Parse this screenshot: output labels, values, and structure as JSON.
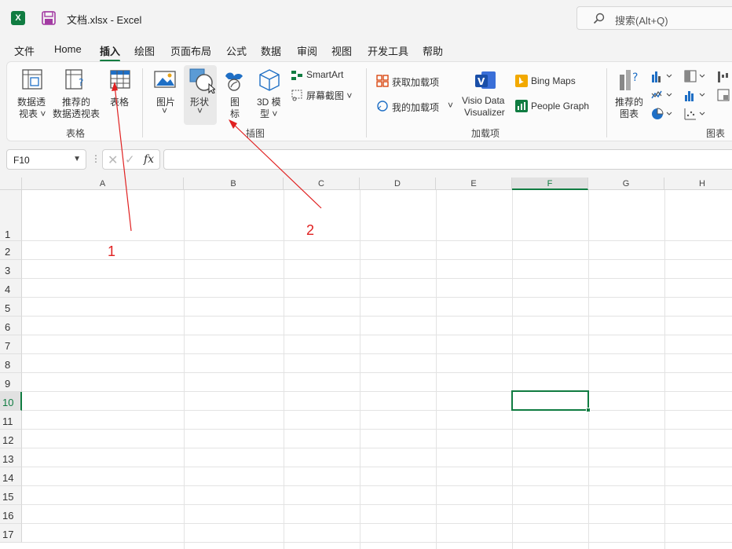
{
  "titlebar": {
    "logo": "X",
    "doc_title": "文档.xlsx  -  Excel",
    "search_placeholder": "搜索(Alt+Q)"
  },
  "tabs": [
    "文件",
    "Home",
    "插入",
    "绘图",
    "页面布局",
    "公式",
    "数据",
    "审阅",
    "视图",
    "开发工具",
    "帮助"
  ],
  "active_tab": "插入",
  "ribbon": {
    "tables_group": {
      "label": "表格",
      "pivot_line1": "数据透",
      "pivot_line2": "视表",
      "rec_pivot_line1": "推荐的",
      "rec_pivot_line2": "数据透视表",
      "table": "表格"
    },
    "illustrations_group": {
      "label": "插图",
      "pictures": "图片",
      "shapes": "形状",
      "icons_line1": "图",
      "icons_line2": "标",
      "model_line1": "3D 模",
      "model_line2": "型",
      "smartart": "SmartArt",
      "screenshot": "屏幕截图"
    },
    "addins_group": {
      "label": "加载项",
      "get_addins": "获取加载项",
      "my_addins": "我的加载项",
      "visio_line1": "Visio Data",
      "visio_line2": "Visualizer",
      "bing_maps": "Bing Maps",
      "people_graph": "People Graph"
    },
    "charts_group": {
      "label": "图表",
      "rec_chart_line1": "推荐的",
      "rec_chart_line2": "图表"
    }
  },
  "formula_bar": {
    "name_box": "F10",
    "fx": "fx",
    "value": ""
  },
  "grid": {
    "columns": [
      "A",
      "B",
      "C",
      "D",
      "E",
      "F",
      "G",
      "H"
    ],
    "rows": [
      "1",
      "2",
      "3",
      "4",
      "5",
      "6",
      "7",
      "8",
      "9",
      "10",
      "11",
      "12",
      "13",
      "14",
      "15",
      "16",
      "17"
    ],
    "selected_cell": "F10"
  },
  "annotations": [
    "1",
    "2"
  ],
  "colors": {
    "accent": "#107c41",
    "annotation": "#e02020"
  }
}
